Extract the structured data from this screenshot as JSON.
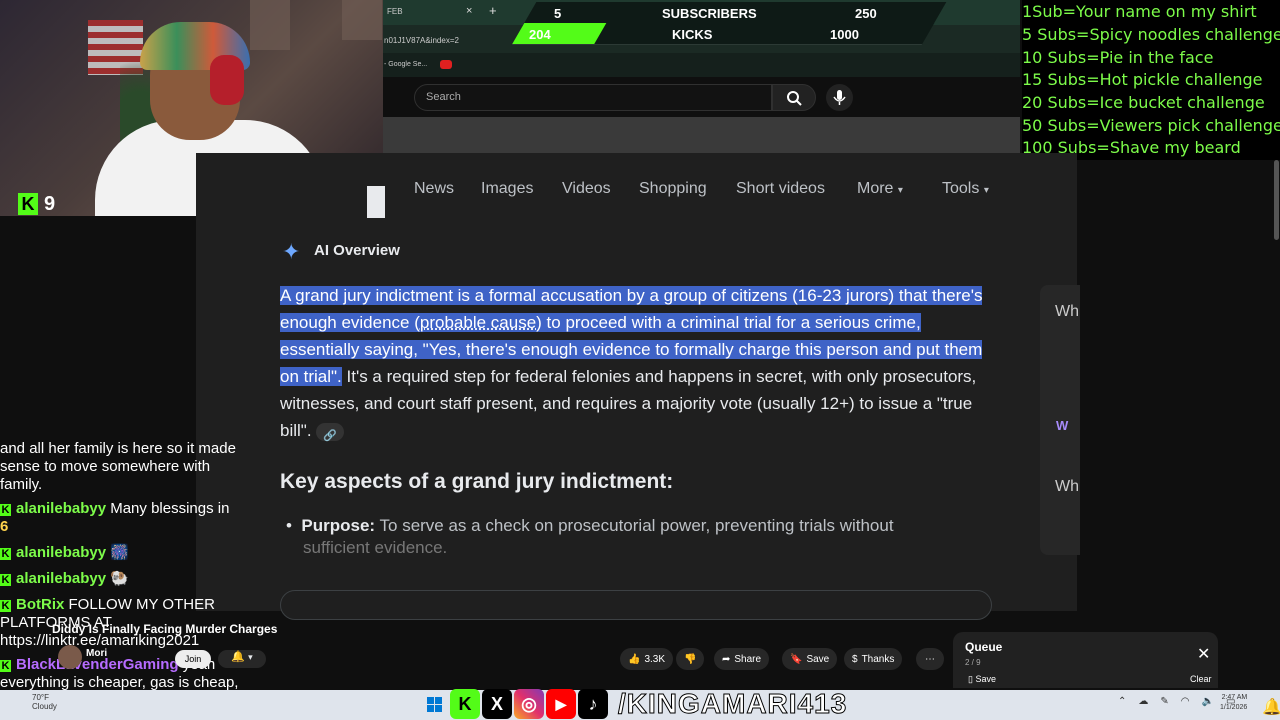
{
  "browser": {
    "tab_label": "FEB",
    "tab_close": "×",
    "tab_add": "+",
    "url": "n01J1V87A&index=2",
    "bookmark": "- Google Se..."
  },
  "stream": {
    "kick_viewers": "9",
    "goals": {
      "subscribers": {
        "current": "5",
        "label": "SUBSCRIBERS",
        "target": "250"
      },
      "kicks": {
        "current": "204",
        "label": "KICKS",
        "target": "1000",
        "progress": 0.2
      }
    },
    "sub_goals": [
      "1Sub=Your name on my shirt",
      "5 Subs=Spicy noodles challenge",
      "10 Subs=Pie in the face",
      "15 Subs=Hot pickle challenge",
      "20 Subs=Ice bucket challenge",
      "50 Subs=Viewers pick challenge",
      "100 Subs=Shave my beard"
    ],
    "handle": "/KINGAMARI413",
    "accent": "#53fc18"
  },
  "youtube": {
    "search_placeholder": "Search",
    "video_title": "Diddy Is Finally Facing Murder Charges",
    "channel": "Mori",
    "join": "Join",
    "likes": "3.3K",
    "share": "Share",
    "save": "Save",
    "thanks": "Thanks",
    "queue": {
      "title": "Queue",
      "count": "2 / 9",
      "save": "Save",
      "clear": "Clear"
    }
  },
  "google": {
    "tabs": [
      "News",
      "Images",
      "Videos",
      "Shopping",
      "Short videos",
      "More",
      "Tools"
    ],
    "ai_title": "AI Overview",
    "ai_highlight": "A grand jury indictment is a formal accusation by a group of citizens (16-23 jurors) that there's enough evidence (",
    "ai_link": "probable cause",
    "ai_highlight_2": ") to proceed with a criminal trial for a serious crime, essentially saying, \"Yes, there's enough evidence to formally charge this person and put them on trial\".",
    "ai_rest": " It's a required step for federal felonies and happens in secret, with only prosecutors, witnesses, and court staff present, and requires a majority vote (usually 12+) to issue a \"true bill\".",
    "key_heading": "Key aspects of a grand jury indictment:",
    "purpose_label": "Purpose:",
    "purpose_text": " To serve as a check on prosecutorial power, preventing trials without",
    "purpose_text_2": "sufficient evidence.",
    "side_1": "Wh",
    "side_2": "Wh"
  },
  "chat": [
    {
      "user": "",
      "text": "and all her family is here so it made sense to move somewhere with family."
    },
    {
      "user": "alanilebabyy",
      "text": "Many blessings in",
      "badge": "6"
    },
    {
      "user": "alanilebabyy",
      "text": "🎆"
    },
    {
      "user": "alanilebabyy",
      "text": "🐏"
    },
    {
      "user": "BotRix",
      "text": "FOLLOW MY OTHER PLATFORMS AT https://linktr.ee/amariking2021"
    },
    {
      "user": "BlackLavenderGaming",
      "text": "yeah everything is cheaper, gas is cheap, food is cheaper, no crazy traffic"
    }
  ],
  "taskbar": {
    "weather_temp": "70°F",
    "weather_desc": "Cloudy",
    "time": "2:47 AM",
    "date": "1/1/2026"
  }
}
